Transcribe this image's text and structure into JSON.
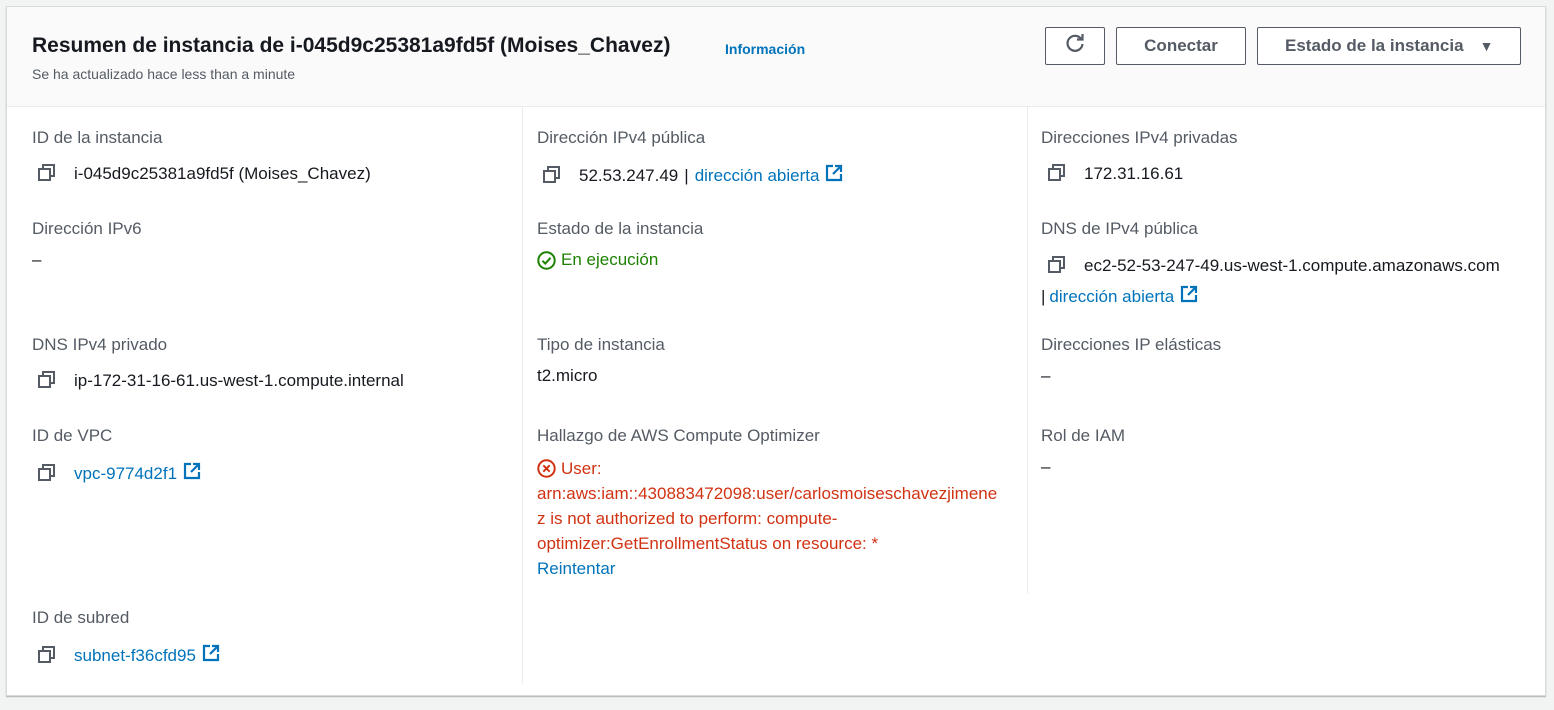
{
  "header": {
    "title": "Resumen de instancia de i-045d9c25381a9fd5f (Moises_Chavez)",
    "info_link": "Información",
    "subtitle": "Se ha actualizado hace less than a minute",
    "connect_label": "Conectar",
    "state_label": "Estado de la instancia",
    "refresh_icon": "refresh-icon",
    "caret_icon": "caret-down-icon"
  },
  "fields": {
    "instance_id": {
      "label": "ID de la instancia",
      "value": "i-045d9c25381a9fd5f (Moises_Chavez)"
    },
    "public_ipv4": {
      "label": "Dirección IPv4 pública",
      "value": "52.53.247.49",
      "sep": "|",
      "link": "dirección abierta"
    },
    "private_ipv4": {
      "label": "Direcciones IPv4 privadas",
      "value": "172.31.16.61"
    },
    "ipv6": {
      "label": "Dirección IPv6",
      "value": "–"
    },
    "instance_state": {
      "label": "Estado de la instancia",
      "value": "En ejecución",
      "color": "#1d8102"
    },
    "public_dns": {
      "label": "DNS de IPv4 pública",
      "value": "ec2-52-53-247-49.us-west-1.compute.amazonaws.com",
      "sep": "|",
      "link": "dirección abierta"
    },
    "private_dns": {
      "label": "DNS IPv4 privado",
      "value": "ip-172-31-16-61.us-west-1.compute.internal"
    },
    "instance_type": {
      "label": "Tipo de instancia",
      "value": "t2.micro"
    },
    "elastic_ip": {
      "label": "Direcciones IP elásticas",
      "value": "–"
    },
    "vpc_id": {
      "label": "ID de VPC",
      "value": "vpc-9774d2f1"
    },
    "optimizer": {
      "label": "Hallazgo de AWS Compute Optimizer",
      "error_lines": [
        "User:",
        "arn:aws:iam::430883472098:user/carlosmoiseschavezjimene",
        "z is not authorized to perform: compute-",
        "optimizer:GetEnrollmentStatus on resource: *"
      ],
      "retry": "Reintentar",
      "color": "#d13212"
    },
    "iam_role": {
      "label": "Rol de IAM",
      "value": "–"
    },
    "subnet_id": {
      "label": "ID de subred",
      "value": "subnet-f36cfd95"
    }
  },
  "colors": {
    "link": "#0073bb",
    "label": "#545b64",
    "success": "#1d8102",
    "error": "#d13212"
  }
}
